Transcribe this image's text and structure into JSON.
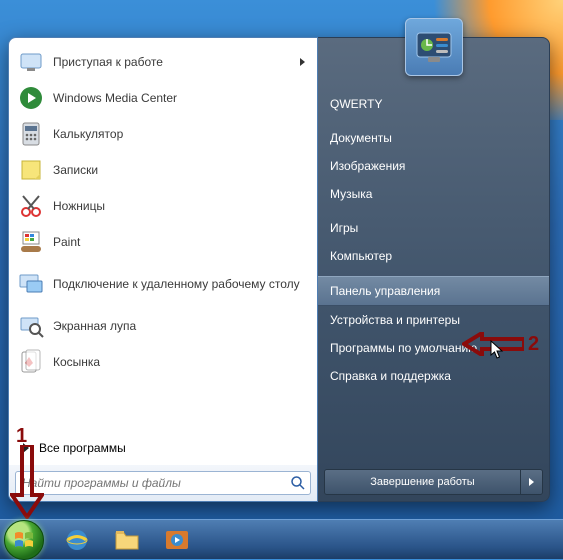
{
  "left_programs": [
    {
      "label": "Приступая к работе",
      "icon": "getting-started",
      "has_arrow": true
    },
    {
      "label": "Windows Media Center",
      "icon": "media-center"
    },
    {
      "label": "Калькулятор",
      "icon": "calculator"
    },
    {
      "label": "Записки",
      "icon": "sticky-notes"
    },
    {
      "label": "Ножницы",
      "icon": "snipping"
    },
    {
      "label": "Paint",
      "icon": "paint"
    },
    {
      "label": "Подключение к удаленному рабочему столу",
      "icon": "rdp",
      "tall": true
    },
    {
      "label": "Экранная лупа",
      "icon": "magnifier"
    },
    {
      "label": "Косынка",
      "icon": "solitaire"
    }
  ],
  "all_programs": "Все программы",
  "search_placeholder": "Найти программы и файлы",
  "right_items": [
    {
      "label": "QWERTY",
      "name": "user-name"
    },
    {
      "label": "Документы",
      "name": "documents"
    },
    {
      "label": "Изображения",
      "name": "pictures"
    },
    {
      "label": "Музыка",
      "name": "music"
    },
    {
      "label": "Игры",
      "name": "games"
    },
    {
      "label": "Компьютер",
      "name": "computer"
    },
    {
      "label": "Панель управления",
      "name": "control-panel",
      "hover": true
    },
    {
      "label": "Устройства и принтеры",
      "name": "devices-printers"
    },
    {
      "label": "Программы по умолчанию",
      "name": "default-programs"
    },
    {
      "label": "Справка и поддержка",
      "name": "help-support"
    }
  ],
  "shutdown_label": "Завершение работы",
  "annotations": {
    "a1": "1",
    "a2": "2"
  }
}
